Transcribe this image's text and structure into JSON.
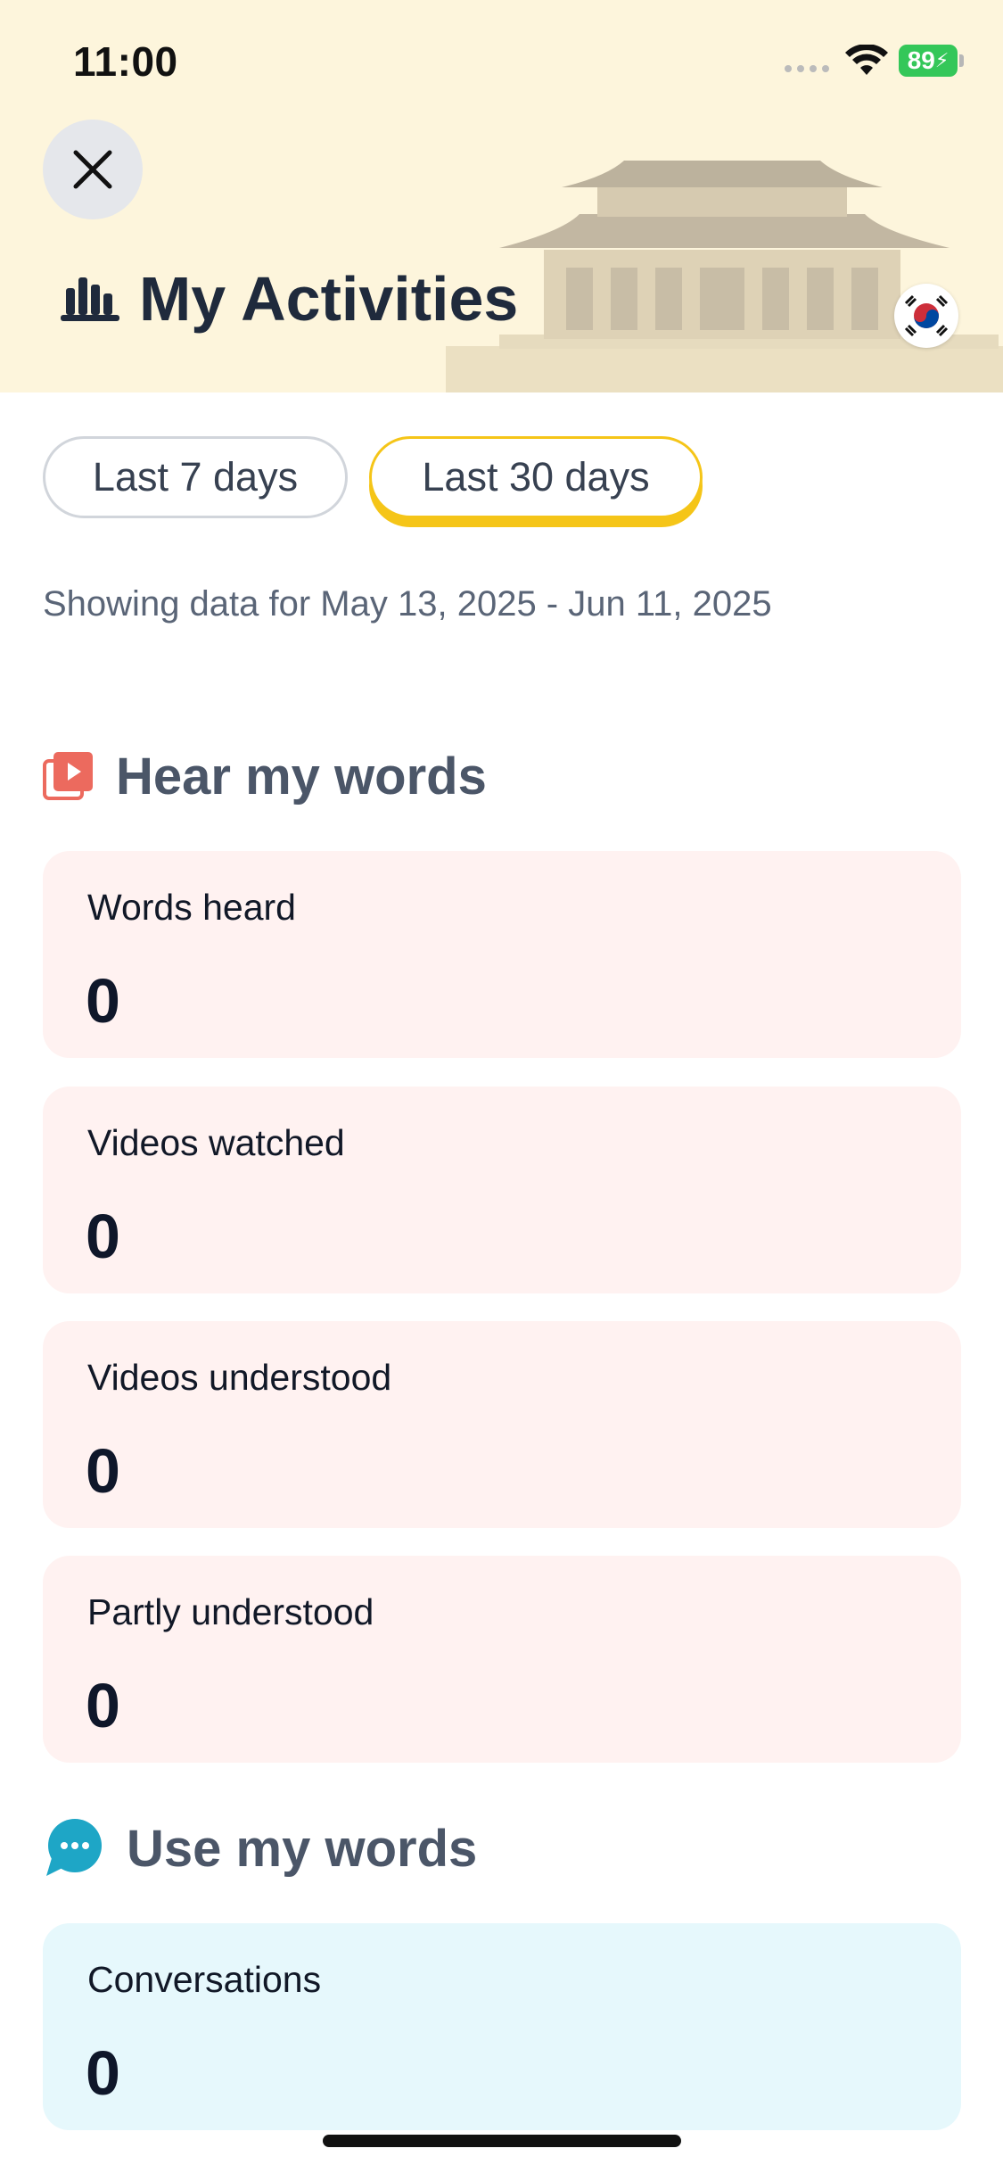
{
  "status_bar": {
    "time": "11:00",
    "battery": "89"
  },
  "header": {
    "title": "My Activities",
    "title_icon": "bar-chart-icon",
    "flag": "south-korea-flag-icon",
    "background": "#fdf5dc"
  },
  "filters": {
    "options": [
      "Last 7 days",
      "Last 30 days"
    ],
    "selected": "Last 30 days",
    "accent": "#f5c518"
  },
  "range_text": "Showing data for May 13, 2025 - Jun 11, 2025",
  "sections": [
    {
      "title": "Hear my words",
      "icon": "video-play-icon",
      "accent": "#ec6a5e",
      "cards": [
        {
          "label": "Words heard",
          "value": "0"
        },
        {
          "label": "Videos watched",
          "value": "0"
        },
        {
          "label": "Videos understood",
          "value": "0"
        },
        {
          "label": "Partly understood",
          "value": "0"
        }
      ]
    },
    {
      "title": "Use my words",
      "icon": "chat-bubble-icon",
      "accent": "#1ea6c6",
      "cards": [
        {
          "label": "Conversations",
          "value": "0"
        }
      ]
    }
  ]
}
